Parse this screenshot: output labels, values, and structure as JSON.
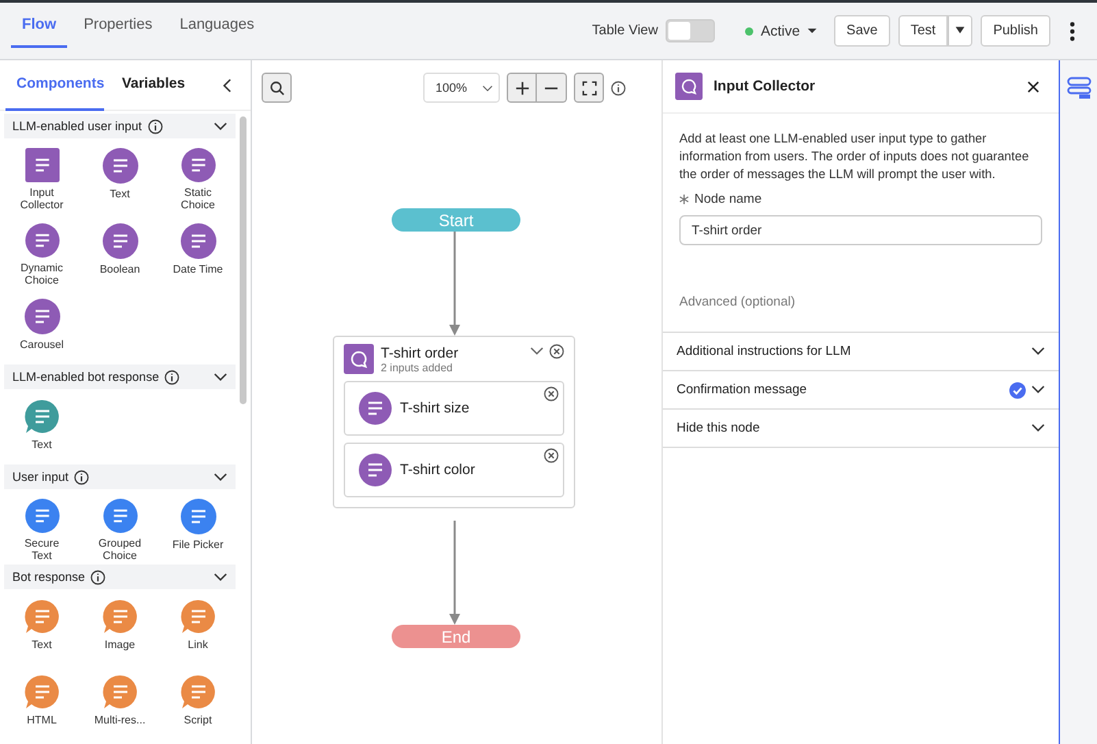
{
  "top_tabs": [
    {
      "label": "Flow",
      "selected": true
    },
    {
      "label": "Properties",
      "selected": false
    },
    {
      "label": "Languages",
      "selected": false
    }
  ],
  "toolbar": {
    "table_view_label": "Table View",
    "table_view_on": false,
    "status": "Active",
    "save": "Save",
    "test": "Test",
    "publish": "Publish"
  },
  "palette": {
    "tabs": [
      {
        "label": "Components",
        "selected": true
      },
      {
        "label": "Variables",
        "selected": false
      }
    ],
    "categories": [
      {
        "title": "LLM-enabled user input",
        "color": "#8e5bb5",
        "items": [
          {
            "label": "Input Collector",
            "kind": "square"
          },
          {
            "label": "Text",
            "kind": "circle"
          },
          {
            "label": "Static Choice",
            "kind": "circle"
          },
          {
            "label": "Dynamic Choice",
            "kind": "circle"
          },
          {
            "label": "Boolean",
            "kind": "circle"
          },
          {
            "label": "Date Time",
            "kind": "circle"
          },
          {
            "label": "Carousel",
            "kind": "circle"
          }
        ]
      },
      {
        "title": "LLM-enabled bot response",
        "color": "#3f9c9c",
        "items": [
          {
            "label": "Text",
            "kind": "bubble"
          }
        ]
      },
      {
        "title": "User input",
        "color": "#3b82f0",
        "items": [
          {
            "label": "Secure Text",
            "kind": "circle"
          },
          {
            "label": "Grouped Choice",
            "kind": "circle"
          },
          {
            "label": "File Picker",
            "kind": "circle"
          }
        ]
      },
      {
        "title": "Bot response",
        "color": "#ea8a45",
        "items": [
          {
            "label": "Text",
            "kind": "bubble"
          },
          {
            "label": "Image",
            "kind": "bubble"
          },
          {
            "label": "Link",
            "kind": "bubble"
          },
          {
            "label": "HTML",
            "kind": "bubble"
          },
          {
            "label": "Multi-res...",
            "kind": "bubble"
          },
          {
            "label": "Script",
            "kind": "bubble"
          }
        ]
      }
    ]
  },
  "canvas": {
    "zoom": "100%",
    "start": "Start",
    "end": "End",
    "node": {
      "title": "T-shirt order",
      "subtitle": "2 inputs added",
      "inputs": [
        {
          "label": "T-shirt size"
        },
        {
          "label": "T-shirt color"
        }
      ]
    }
  },
  "panel": {
    "title": "Input Collector",
    "description": "Add at least one LLM-enabled user input type to gather information from users. The order of inputs does not guarantee the order of messages the LLM will prompt the user with.",
    "node_name_label": "Node name",
    "node_name_value": "T-shirt order",
    "advanced": "Advanced (optional)",
    "sections": [
      {
        "label": "Additional instructions for LLM",
        "confirmed": false
      },
      {
        "label": "Confirmation message",
        "confirmed": true
      },
      {
        "label": "Hide this node",
        "confirmed": false
      }
    ]
  }
}
